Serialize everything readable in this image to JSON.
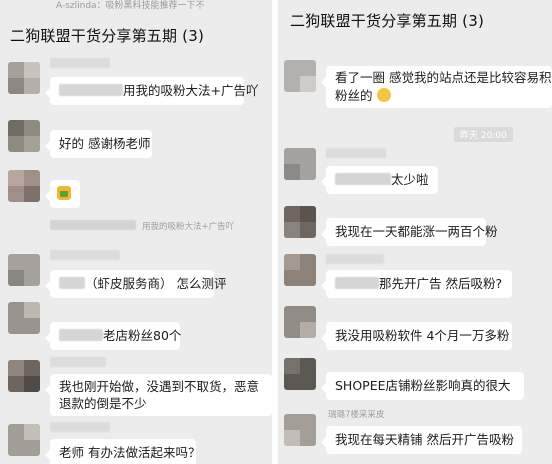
{
  "left": {
    "top_caption": "A-szlinda：吸粉黑科技能推荐一下不",
    "title": "二狗联盟干货分享第五期 (3)",
    "messages": [
      "用我的吸粉大法+广告吖",
      "好的  感谢杨老师",
      "",
      "（虾皮服务商）  怎么测评",
      "老店粉丝80个",
      "我也刚开始做，没遇到不取货，恶意退款的倒是不少",
      "老师 有办法做活起来吗？"
    ],
    "quote_text": "用我的吸粉大法+广告吖",
    "emoji_label": "thumbs-up"
  },
  "right": {
    "title": "二狗联盟干货分享第五期 (3)",
    "messages": [
      "看了一圈 感觉我的站点还是比较容易积累粉丝的",
      "太少啦",
      "我现在一天都能涨一两百个粉",
      "那先开广告 然后吸粉?",
      "我没用吸粉软件 4个月一万多粉",
      "SHOPEE店铺粉丝影响真的很大",
      "我现在每天精铺 然后开广告吸粉"
    ],
    "message_1_line1": "看了一圈 感觉我的站点还是比较容易积累",
    "message_1_line2": "粉丝的",
    "timestamp": "昨天 20:00",
    "sub_caption": "瑞璐7楼采采皮"
  }
}
